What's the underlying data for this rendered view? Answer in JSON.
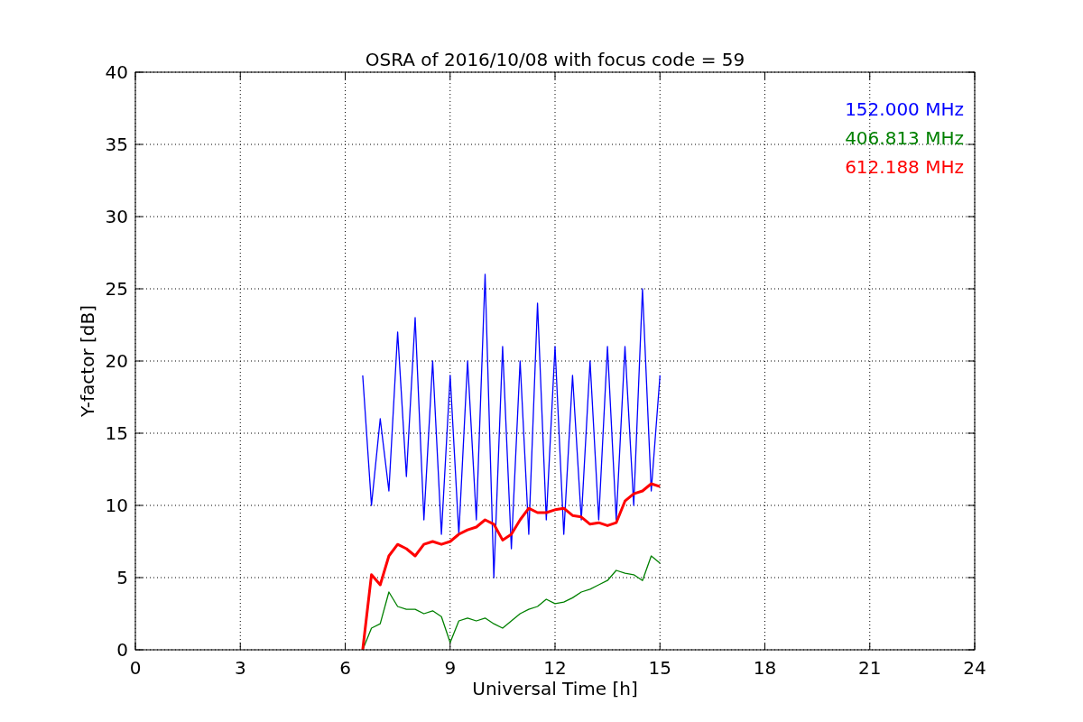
{
  "chart_data": {
    "type": "line",
    "title": "OSRA of 2016/10/08 with focus code = 59",
    "xlabel": "Universal Time [h]",
    "ylabel": "Y-factor [dB]",
    "x": [
      6.5,
      6.75,
      7,
      7.25,
      7.5,
      7.75,
      8,
      8.25,
      8.5,
      8.75,
      9,
      9.25,
      9.5,
      9.75,
      10,
      10.25,
      10.5,
      10.75,
      11,
      11.25,
      11.5,
      11.75,
      12,
      12.25,
      12.5,
      12.75,
      13,
      13.25,
      13.5,
      13.75,
      14,
      14.25,
      14.5,
      14.75,
      15
    ],
    "series": [
      {
        "name": "152.000 MHz",
        "color": "#0000ff",
        "values": [
          19,
          10,
          16,
          11,
          22,
          12,
          23,
          9,
          20,
          8,
          19,
          8,
          20,
          9,
          26,
          5,
          21,
          7,
          20,
          8,
          24,
          9,
          21,
          8,
          19,
          9,
          20,
          9,
          21,
          9,
          21,
          10,
          25,
          11,
          19
        ]
      },
      {
        "name": "406.813 MHz",
        "color": "#008000",
        "values": [
          0,
          1.5,
          1.8,
          4,
          3,
          2.8,
          2.8,
          2.5,
          2.7,
          2.3,
          0.5,
          2,
          2.2,
          2,
          2.2,
          1.8,
          1.5,
          2,
          2.5,
          2.8,
          3,
          3.5,
          3.2,
          3.3,
          3.6,
          4,
          4.2,
          4.5,
          4.8,
          5.5,
          5.3,
          5.2,
          4.8,
          6.5,
          6
        ]
      },
      {
        "name": "612.188 MHz",
        "color": "#ff0000",
        "values": [
          0,
          5.2,
          4.5,
          6.5,
          7.3,
          7,
          6.5,
          7.3,
          7.5,
          7.3,
          7.5,
          8,
          8.3,
          8.5,
          9,
          8.7,
          7.6,
          8,
          9,
          9.8,
          9.5,
          9.5,
          9.7,
          9.8,
          9.3,
          9.2,
          8.7,
          8.8,
          8.6,
          8.8,
          10.3,
          10.8,
          11,
          11.5,
          11.3
        ]
      }
    ],
    "grid": true,
    "xlim": [
      0,
      24
    ],
    "ylim": [
      0,
      40
    ],
    "xticks": [
      0,
      3,
      6,
      9,
      12,
      15,
      18,
      21,
      24
    ],
    "yticks": [
      0,
      5,
      10,
      15,
      20,
      25,
      30,
      35,
      40
    ]
  }
}
